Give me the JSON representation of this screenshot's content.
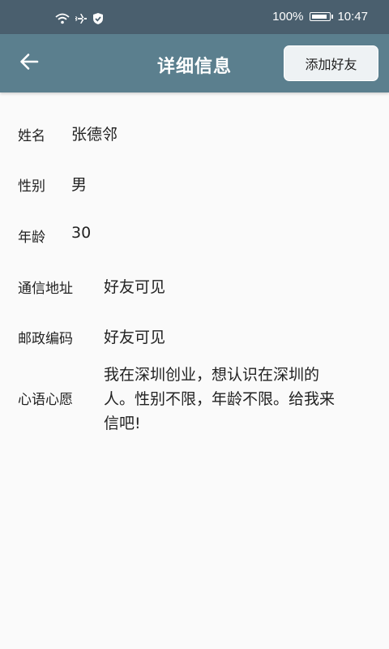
{
  "status_bar": {
    "battery": "100%",
    "battery_level": 1.0,
    "time": "10:47",
    "icons": [
      "wifi-icon",
      "airplane-icon",
      "shield-check-icon",
      "battery-charging-icon"
    ]
  },
  "header": {
    "title": "详细信息",
    "back_icon": "arrow-left-icon",
    "add_friend_label": "添加好友"
  },
  "colors": {
    "status_bar": "#4a5f6e",
    "app_bar": "#5b7f8e",
    "background": "#fafafa"
  },
  "fields": [
    {
      "label": "姓名",
      "value": "张德邻"
    },
    {
      "label": "性别",
      "value": "男"
    },
    {
      "label": "年龄",
      "value": "30"
    },
    {
      "label": "通信地址",
      "value": "好友可见"
    },
    {
      "label": "邮政编码",
      "value": "好友可见"
    },
    {
      "label": "心语心愿",
      "value": [
        "我在深圳创业，想认识在深圳的",
        "人。性别不限，年龄不限。给我来",
        "信吧!"
      ]
    }
  ]
}
